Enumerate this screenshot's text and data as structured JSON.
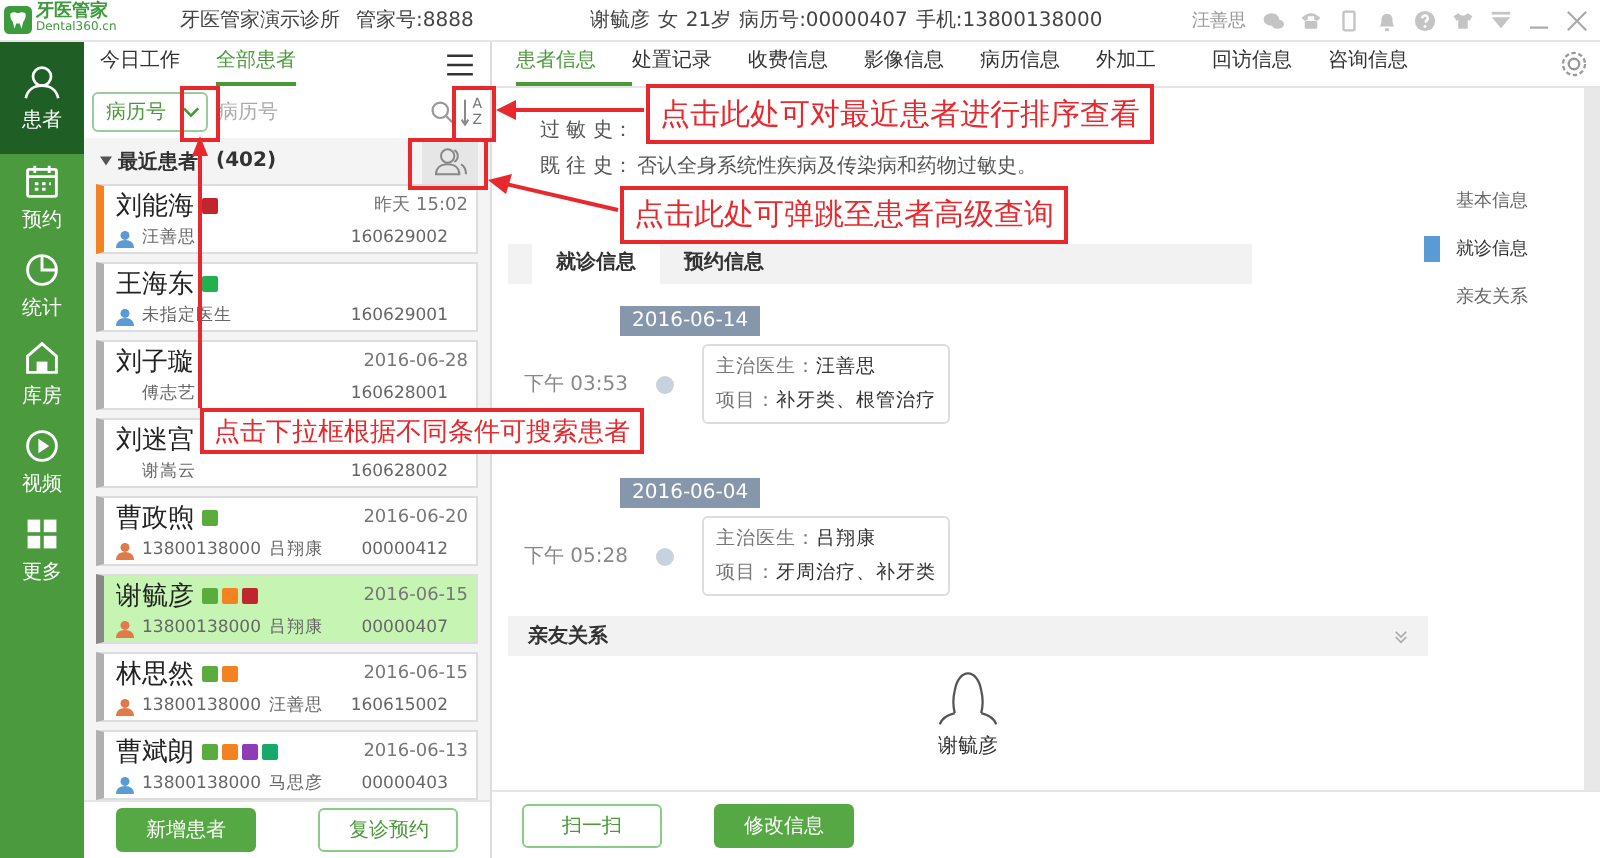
{
  "top_bar": {
    "logo_name": "牙医管家",
    "logo_domain": "Dental360.cn",
    "clinic": "牙医管家演示诊所",
    "account": "管家号:8888",
    "patient_name": "谢毓彦",
    "patient_gender": "女",
    "patient_age": "21岁",
    "record_no": "病历号:00000407",
    "phone": "手机:13800138000",
    "user": "汪善思"
  },
  "nav": [
    {
      "label": "患者",
      "selected": true
    },
    {
      "label": "预约",
      "selected": false
    },
    {
      "label": "统计",
      "selected": false
    },
    {
      "label": "库房",
      "selected": false
    },
    {
      "label": "视频",
      "selected": false
    },
    {
      "label": "更多",
      "selected": false
    }
  ],
  "list_tabs": [
    {
      "label": "今日工作",
      "selected": false
    },
    {
      "label": "全部患者",
      "selected": true
    }
  ],
  "search": {
    "field": "病历号",
    "placeholder": "病历号",
    "sort_letters": [
      "A",
      "Z"
    ]
  },
  "group": {
    "label": "最近患者",
    "count": "(402)",
    "expanded": true
  },
  "patients": [
    {
      "name": "刘能海",
      "tags": [
        {
          "color": "#c0262d"
        }
      ],
      "date": "昨天 15:02",
      "doctor": "汪善思",
      "record": "160629002",
      "contact_icon": {
        "color": "#5b9bd5"
      },
      "color": "#f58220",
      "selected": false
    },
    {
      "name": "王海东",
      "tags": [
        {
          "color": "#22b14c"
        }
      ],
      "doctor": "未指定医生",
      "record": "160629001",
      "contact_icon": {
        "color": "#5b9bd5"
      },
      "color": "#b0b0b0",
      "selected": false
    },
    {
      "name": "刘子璇",
      "date": "2016-06-28",
      "doctor": "傅志艺",
      "record": "160628001",
      "color": "#b0b0b0",
      "selected": false
    },
    {
      "name": "刘迷宫",
      "doctor": "谢嵩云",
      "record": "160628002",
      "color": "#b0b0b0",
      "selected": false
    },
    {
      "name": "曹政煦",
      "tags": [
        {
          "color": "#5aad3c"
        }
      ],
      "date": "2016-06-20",
      "phone": "13800138000",
      "doctor": "吕翔康",
      "record": "00000412",
      "contact_icon": {
        "color": "#e07a4a"
      },
      "color": "#b0b0b0",
      "selected": false
    },
    {
      "name": "谢毓彦",
      "tags": [
        {
          "color": "#5aad3c"
        },
        {
          "color": "#f58220"
        },
        {
          "color": "#c0262d"
        }
      ],
      "date": "2016-06-15",
      "phone": "13800138000",
      "doctor": "吕翔康",
      "record": "00000407",
      "contact_icon": {
        "color": "#e07a4a"
      },
      "color": "#888888",
      "selected": true
    },
    {
      "name": "林思然",
      "tags": [
        {
          "color": "#5aad3c"
        },
        {
          "color": "#f58220"
        }
      ],
      "date": "2016-06-15",
      "phone": "13800138000",
      "doctor": "汪善思",
      "record": "160615002",
      "contact_icon": {
        "color": "#e07a4a"
      },
      "color": "#b0b0b0",
      "selected": false
    },
    {
      "name": "曹斌朗",
      "tags": [
        {
          "color": "#5aad3c"
        },
        {
          "color": "#f58220"
        },
        {
          "color": "#8e3bb5"
        },
        {
          "color": "#17a86b"
        }
      ],
      "date": "2016-06-13",
      "phone": "13800138000",
      "doctor": "马思彦",
      "record": "00000403",
      "contact_icon": {
        "color": "#5b9bd5"
      },
      "color": "#b0b0b0",
      "selected": false
    }
  ],
  "list_buttons": [
    {
      "label": "新增患者",
      "kind": "primary"
    },
    {
      "label": "复诊预约",
      "kind": "outline"
    }
  ],
  "content_tabs": [
    {
      "label": "患者信息",
      "selected": true
    },
    {
      "label": "处置记录",
      "selected": false
    },
    {
      "label": "收费信息",
      "selected": false
    },
    {
      "label": "影像信息",
      "selected": false
    },
    {
      "label": "病历信息",
      "selected": false
    },
    {
      "label": "外加工",
      "selected": false
    },
    {
      "label": "回访信息",
      "selected": false
    },
    {
      "label": "咨询信息",
      "selected": false
    }
  ],
  "history": [
    {
      "label": "过 敏 史："
    },
    {
      "label": "既 往 史：",
      "value": "否认全身系统性疾病及传染病和药物过敏史。"
    }
  ],
  "visit_tabs": [
    {
      "label": "就诊信息",
      "selected": true
    },
    {
      "label": "预约信息",
      "selected": false
    }
  ],
  "visits": [
    {
      "date": "2016-06-14",
      "time": "下午 03:53",
      "doctor_label": "主治医生：",
      "doctor": "汪善思",
      "items_label": "项目：",
      "items": "补牙类、根管治疗"
    },
    {
      "date": "2016-06-04",
      "time": "下午 05:28",
      "doctor_label": "主治医生：",
      "doctor": "吕翔康",
      "items_label": "项目：",
      "items": "牙周治疗、补牙类"
    }
  ],
  "relatives": {
    "title": "亲友关系",
    "person": "谢毓彦"
  },
  "content_buttons": [
    {
      "label": "扫一扫",
      "kind": "outline"
    },
    {
      "label": "修改信息",
      "kind": "primary"
    }
  ],
  "section_nav": [
    {
      "label": "基本信息",
      "selected": false
    },
    {
      "label": "就诊信息",
      "selected": true
    },
    {
      "label": "亲友关系",
      "selected": false
    }
  ],
  "annotations": [
    {
      "text": "点击此处可对最近患者进行排序查看"
    },
    {
      "text": "点击此处可弹跳至患者高级查询"
    },
    {
      "text": "点击下拉框根据不同条件可搜索患者"
    }
  ]
}
